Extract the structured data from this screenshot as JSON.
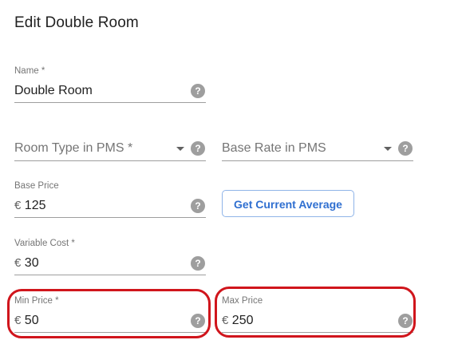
{
  "title": "Edit Double Room",
  "fields": {
    "name": {
      "label": "Name *",
      "value": "Double Room"
    },
    "room_type": {
      "placeholder": "Room Type in PMS *"
    },
    "base_rate": {
      "placeholder": "Base Rate in PMS"
    },
    "base_price": {
      "label": "Base Price",
      "currency": "€",
      "value": "125"
    },
    "variable_cost": {
      "label": "Variable Cost *",
      "currency": "€",
      "value": "30"
    },
    "min_price": {
      "label": "Min Price *",
      "currency": "€",
      "value": "50"
    },
    "max_price": {
      "label": "Max Price",
      "currency": "€",
      "value": "250"
    }
  },
  "buttons": {
    "get_current_average": "Get Current Average"
  },
  "help_glyph": "?",
  "icons": {
    "help": "help-circle-icon",
    "dropdown": "caret-down-icon"
  },
  "colors": {
    "highlight": "#d0151c",
    "button_text": "#2f6fd0",
    "button_border": "#8fb4e8",
    "help_icon": "#9e9e9e"
  }
}
